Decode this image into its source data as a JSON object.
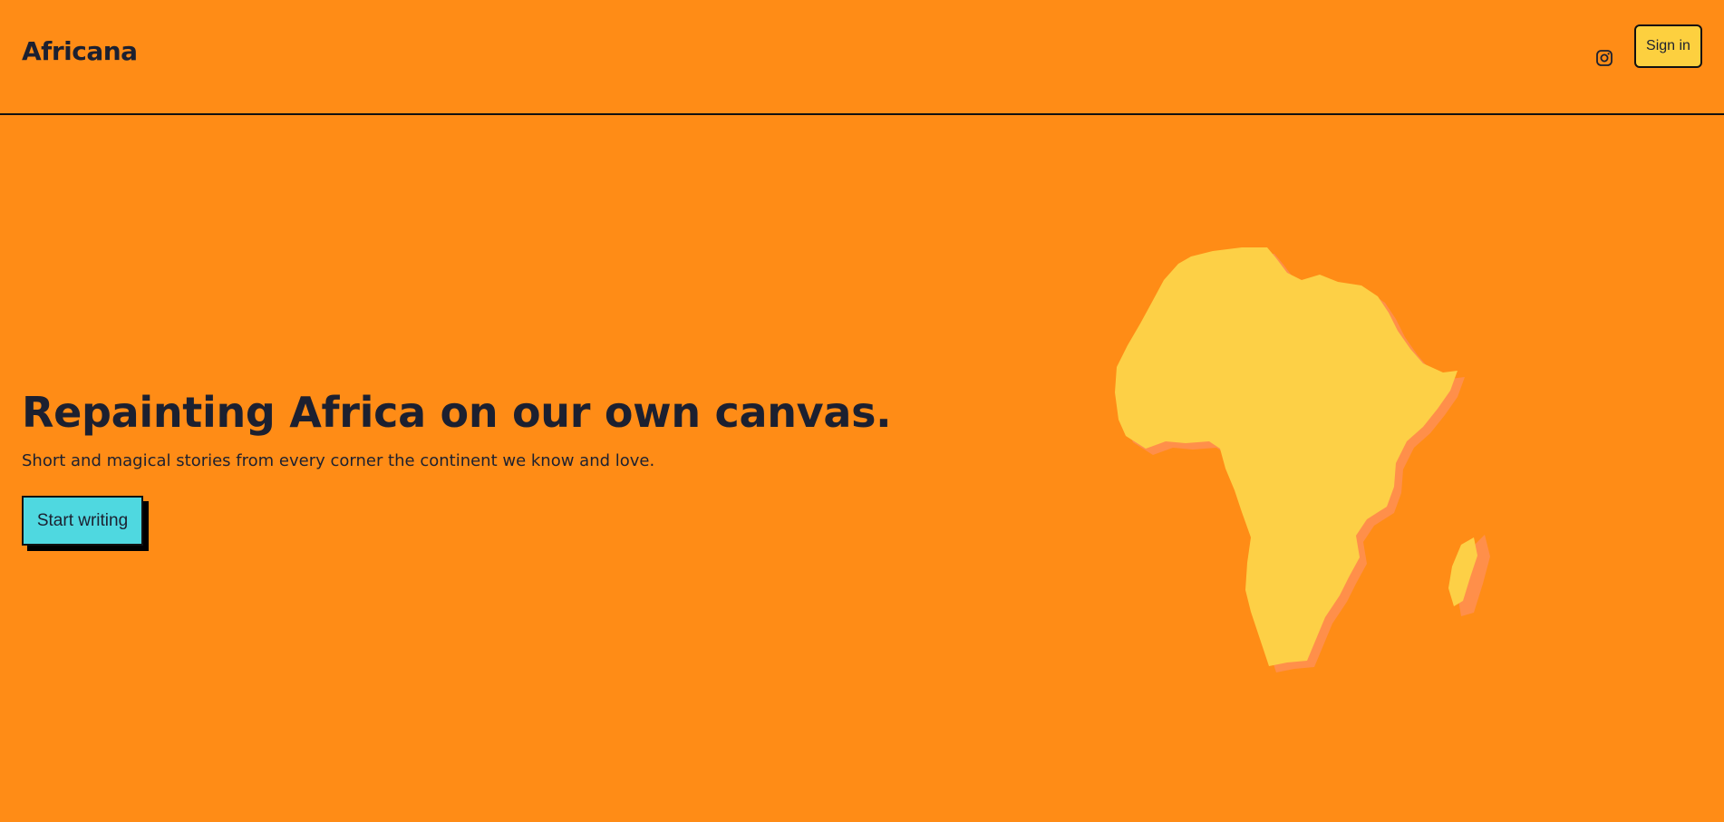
{
  "header": {
    "brand": "Africana",
    "instagram_icon": "instagram-icon",
    "sign_in_label": "Sign in"
  },
  "hero": {
    "title": "Repainting Africa on our own canvas.",
    "subtitle": "Short and magical stories from every corner the continent we know and love.",
    "cta_label": "Start writing",
    "illustration_icon": "africa-map-icon"
  },
  "colors": {
    "background": "#ff8c16",
    "text": "#1c2030",
    "sign_in_bg": "#fdd03f",
    "cta_bg": "#4fd8e0",
    "map_fill": "#fdd046",
    "map_shadow": "#ff8f4a"
  }
}
